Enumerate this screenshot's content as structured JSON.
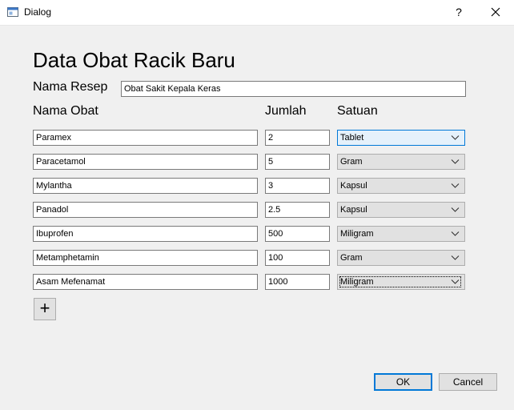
{
  "window": {
    "title": "Dialog",
    "help_label": "?",
    "close_label": "✕"
  },
  "heading": "Data Obat Racik Baru",
  "recipe": {
    "label": "Nama Resep",
    "value": "Obat Sakit Kepala Keras"
  },
  "columns": {
    "name": "Nama Obat",
    "amount": "Jumlah",
    "unit": "Satuan"
  },
  "rows": [
    {
      "name": "Paramex",
      "amount": "2",
      "unit": "Tablet"
    },
    {
      "name": "Paracetamol",
      "amount": "5",
      "unit": "Gram"
    },
    {
      "name": "Mylantha",
      "amount": "3",
      "unit": "Kapsul"
    },
    {
      "name": "Panadol",
      "amount": "2.5",
      "unit": "Kapsul"
    },
    {
      "name": "Ibuprofen",
      "amount": "500",
      "unit": "Miligram"
    },
    {
      "name": "Metamphetamin",
      "amount": "100",
      "unit": "Gram"
    },
    {
      "name": "Asam Mefenamat",
      "amount": "1000",
      "unit": "Miligram"
    }
  ],
  "add_label": "+",
  "buttons": {
    "ok": "OK",
    "cancel": "Cancel"
  },
  "colors": {
    "accent": "#0078d7",
    "background": "#f0f0f0"
  },
  "icons": {
    "app": "window-icon",
    "chevron": "chevron-down-icon",
    "add": "plus-icon"
  }
}
